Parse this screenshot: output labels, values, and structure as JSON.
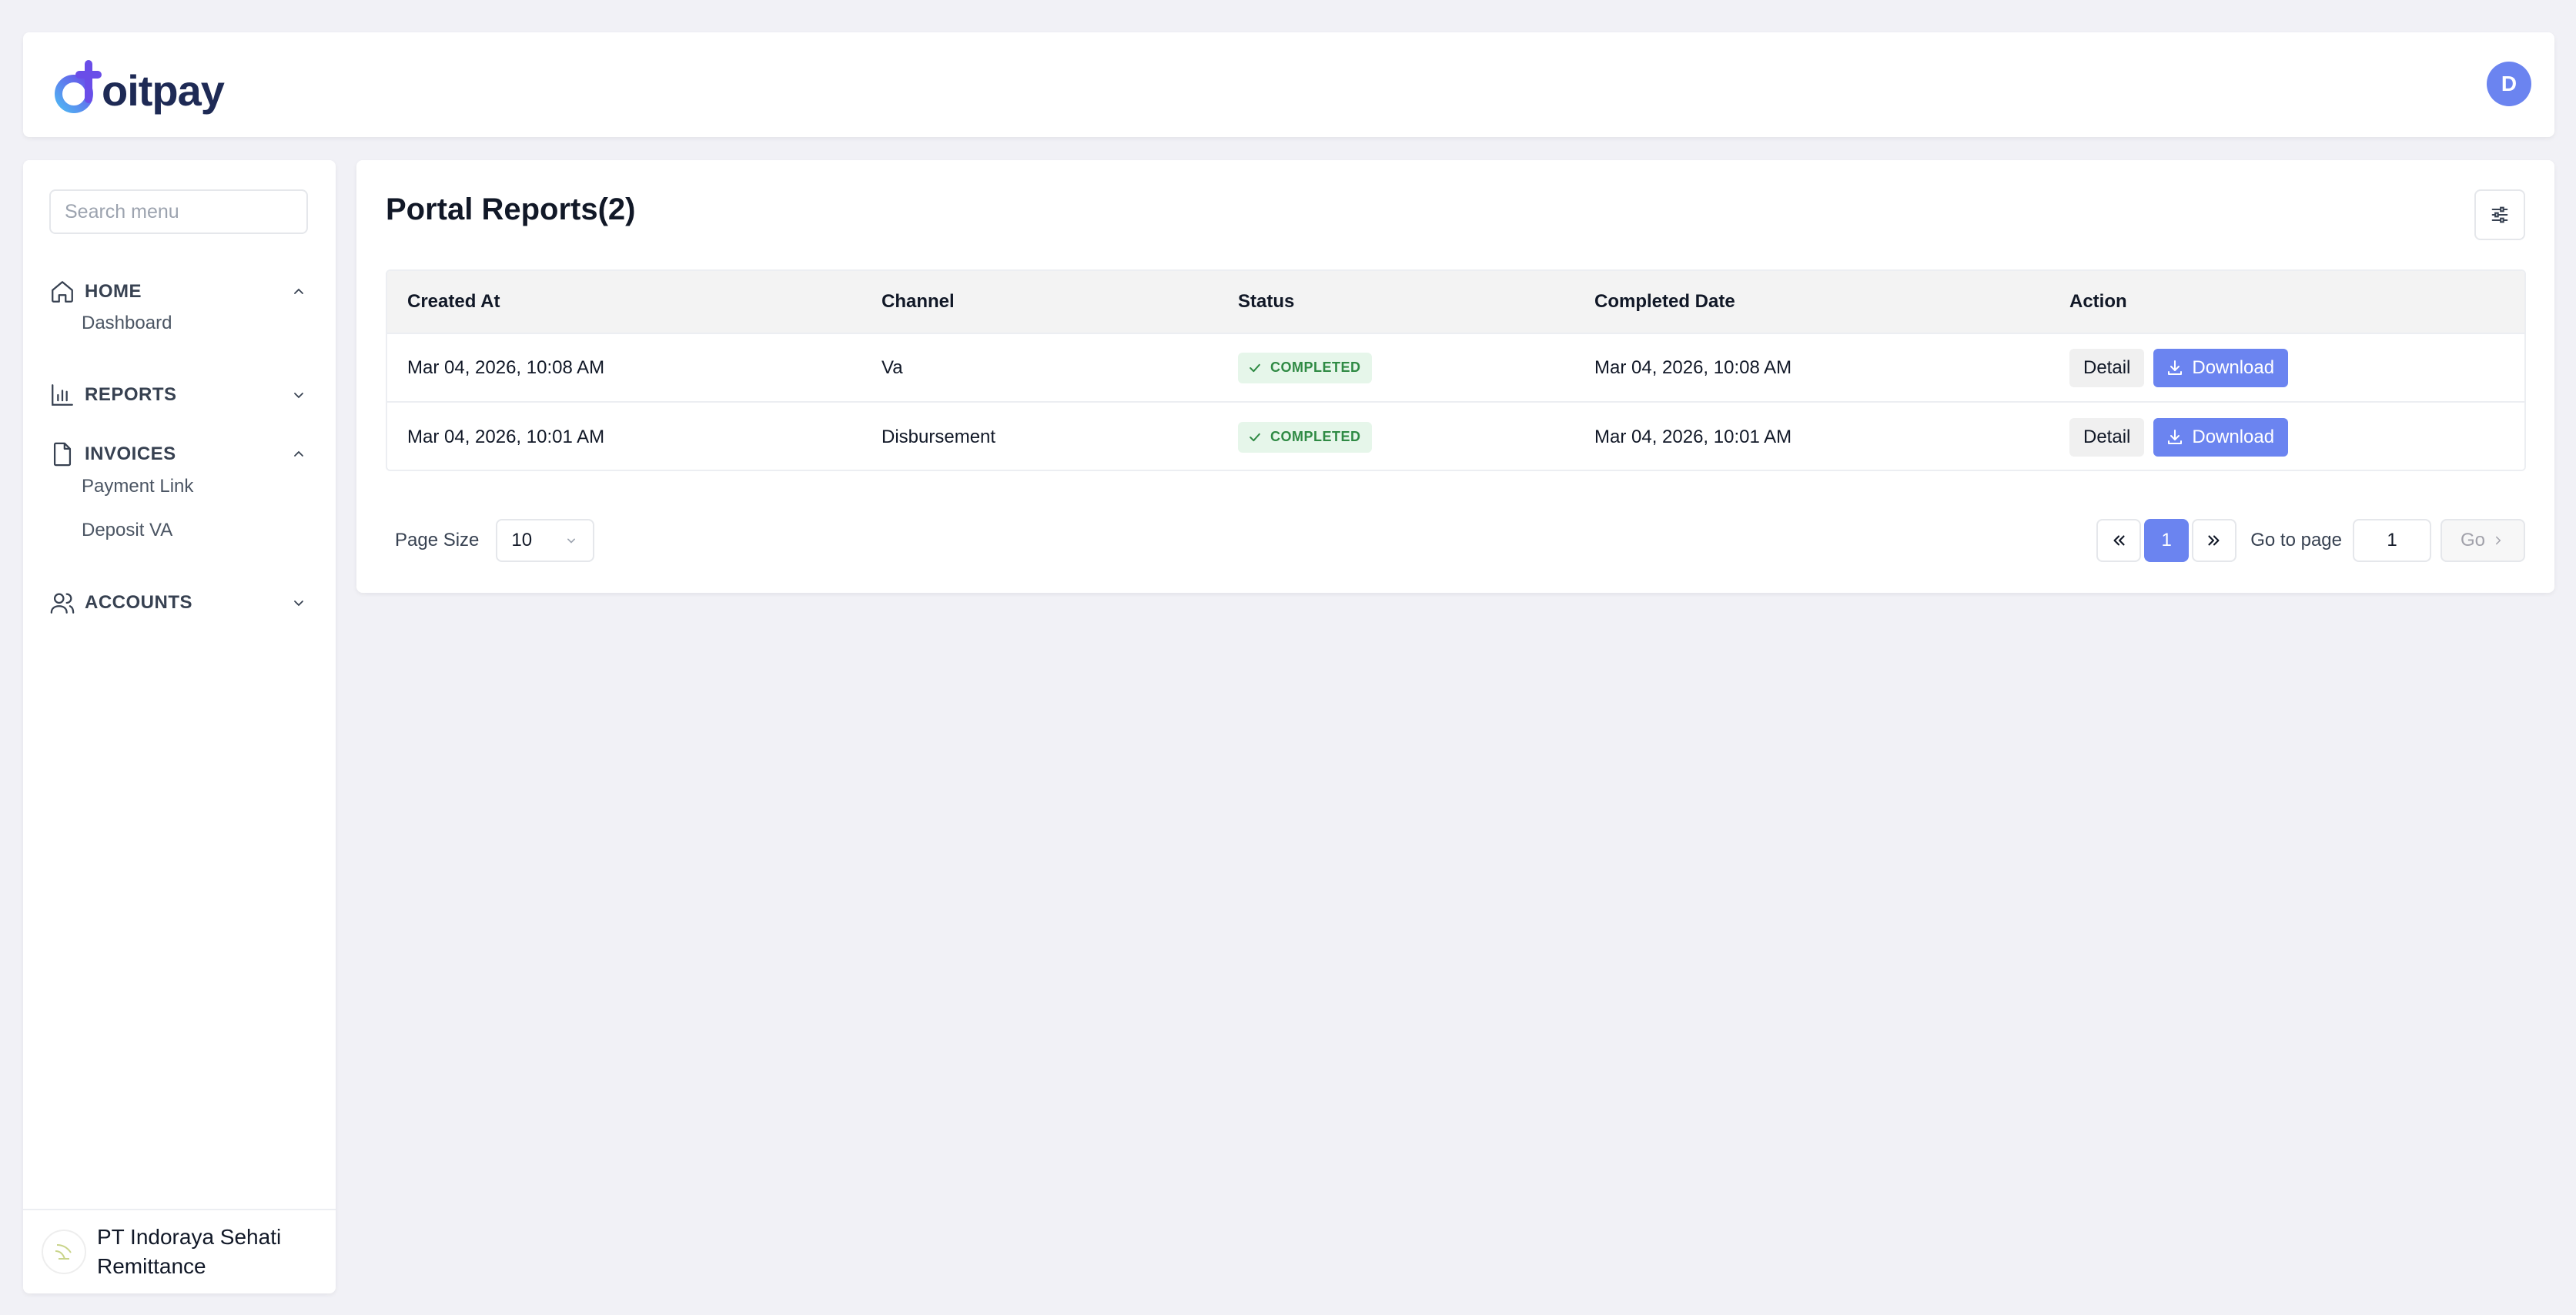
{
  "brand": {
    "logo_text": "oitpay",
    "accent_color": "#6b84f0",
    "dark_color": "#1e2a55"
  },
  "header": {
    "avatar_initial": "D"
  },
  "sidebar": {
    "search_placeholder": "Search menu",
    "groups": [
      {
        "label": "HOME",
        "icon": "home-icon",
        "expanded": true,
        "items": [
          "Dashboard"
        ]
      },
      {
        "label": "REPORTS",
        "icon": "bar-chart-icon",
        "expanded": false,
        "items": []
      },
      {
        "label": "INVOICES",
        "icon": "document-icon",
        "expanded": true,
        "items": [
          "Payment Link",
          "Deposit VA"
        ]
      },
      {
        "label": "ACCOUNTS",
        "icon": "users-icon",
        "expanded": false,
        "items": []
      }
    ],
    "company_name": "PT Indoraya Sehati Remittance"
  },
  "main": {
    "title": "Portal Reports(2)",
    "table": {
      "columns": [
        "Created At",
        "Channel",
        "Status",
        "Completed Date",
        "Action"
      ],
      "rows": [
        {
          "created_at": "Mar 04, 2026, 10:08 AM",
          "channel": "Va",
          "status": "COMPLETED",
          "completed_date": "Mar 04, 2026, 10:08 AM",
          "detail_label": "Detail",
          "download_label": "Download"
        },
        {
          "created_at": "Mar 04, 2026, 10:01 AM",
          "channel": "Disbursement",
          "status": "COMPLETED",
          "completed_date": "Mar 04, 2026, 10:01 AM",
          "detail_label": "Detail",
          "download_label": "Download"
        }
      ]
    },
    "pagination": {
      "page_size_label": "Page Size",
      "page_size_value": "10",
      "current_page": "1",
      "goto_label": "Go to page",
      "goto_value": "1",
      "go_label": "Go"
    }
  }
}
